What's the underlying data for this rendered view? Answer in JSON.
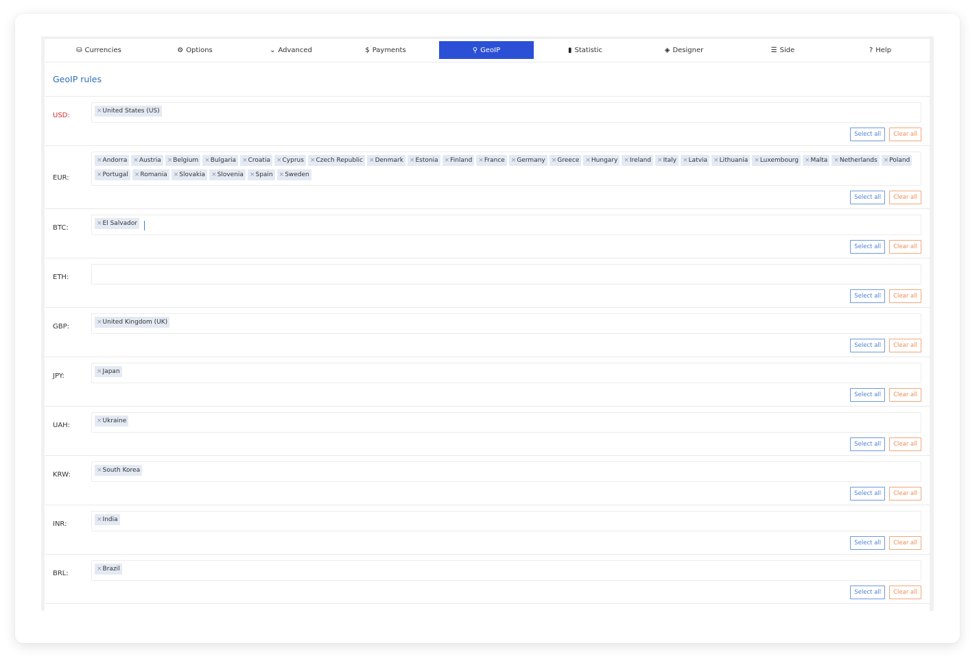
{
  "tabs": [
    {
      "label": "Currencies",
      "icon": "coins-icon",
      "glyph": "⛁"
    },
    {
      "label": "Options",
      "icon": "gear-icon",
      "glyph": "⚙"
    },
    {
      "label": "Advanced",
      "icon": "chevron-wave-icon",
      "glyph": "⌄"
    },
    {
      "label": "Payments",
      "icon": "dollar-icon",
      "glyph": "$"
    },
    {
      "label": "GeoIP",
      "icon": "map-pin-icon",
      "glyph": "⚲"
    },
    {
      "label": "Statistic",
      "icon": "bar-chart-icon",
      "glyph": "▮"
    },
    {
      "label": "Designer",
      "icon": "cube-icon",
      "glyph": "◈"
    },
    {
      "label": "Side",
      "icon": "sliders-icon",
      "glyph": "☰"
    },
    {
      "label": "Help",
      "icon": "question-circle-icon",
      "glyph": "?"
    }
  ],
  "active_tab": "GeoIP",
  "section": {
    "title": "GeoIP rules"
  },
  "buttons": {
    "select_all": "Select all",
    "clear_all": "Clear all"
  },
  "rules": [
    {
      "currency": "USD:",
      "highlight": true,
      "countries": [
        "United States (US)"
      ]
    },
    {
      "currency": "EUR:",
      "countries": [
        "Andorra",
        "Austria",
        "Belgium",
        "Bulgaria",
        "Croatia",
        "Cyprus",
        "Czech Republic",
        "Denmark",
        "Estonia",
        "Finland",
        "France",
        "Germany",
        "Greece",
        "Hungary",
        "Ireland",
        "Italy",
        "Latvia",
        "Lithuania",
        "Luxembourg",
        "Malta",
        "Netherlands",
        "Poland",
        "Portugal",
        "Romania",
        "Slovakia",
        "Slovenia",
        "Spain",
        "Sweden"
      ]
    },
    {
      "currency": "BTC:",
      "countries": [
        "El Salvador"
      ],
      "focused": true
    },
    {
      "currency": "ETH:",
      "countries": []
    },
    {
      "currency": "GBP:",
      "countries": [
        "United Kingdom (UK)"
      ]
    },
    {
      "currency": "JPY:",
      "countries": [
        "Japan"
      ]
    },
    {
      "currency": "UAH:",
      "countries": [
        "Ukraine"
      ]
    },
    {
      "currency": "KRW:",
      "countries": [
        "South Korea"
      ]
    },
    {
      "currency": "INR:",
      "countries": [
        "India"
      ]
    },
    {
      "currency": "BRL:",
      "countries": [
        "Brazil"
      ]
    }
  ],
  "colors": {
    "accent": "#2b50d6",
    "title": "#2a6fb8",
    "select": "#4b7fd6",
    "clear": "#f08a52",
    "usd_label": "#d8262b"
  }
}
